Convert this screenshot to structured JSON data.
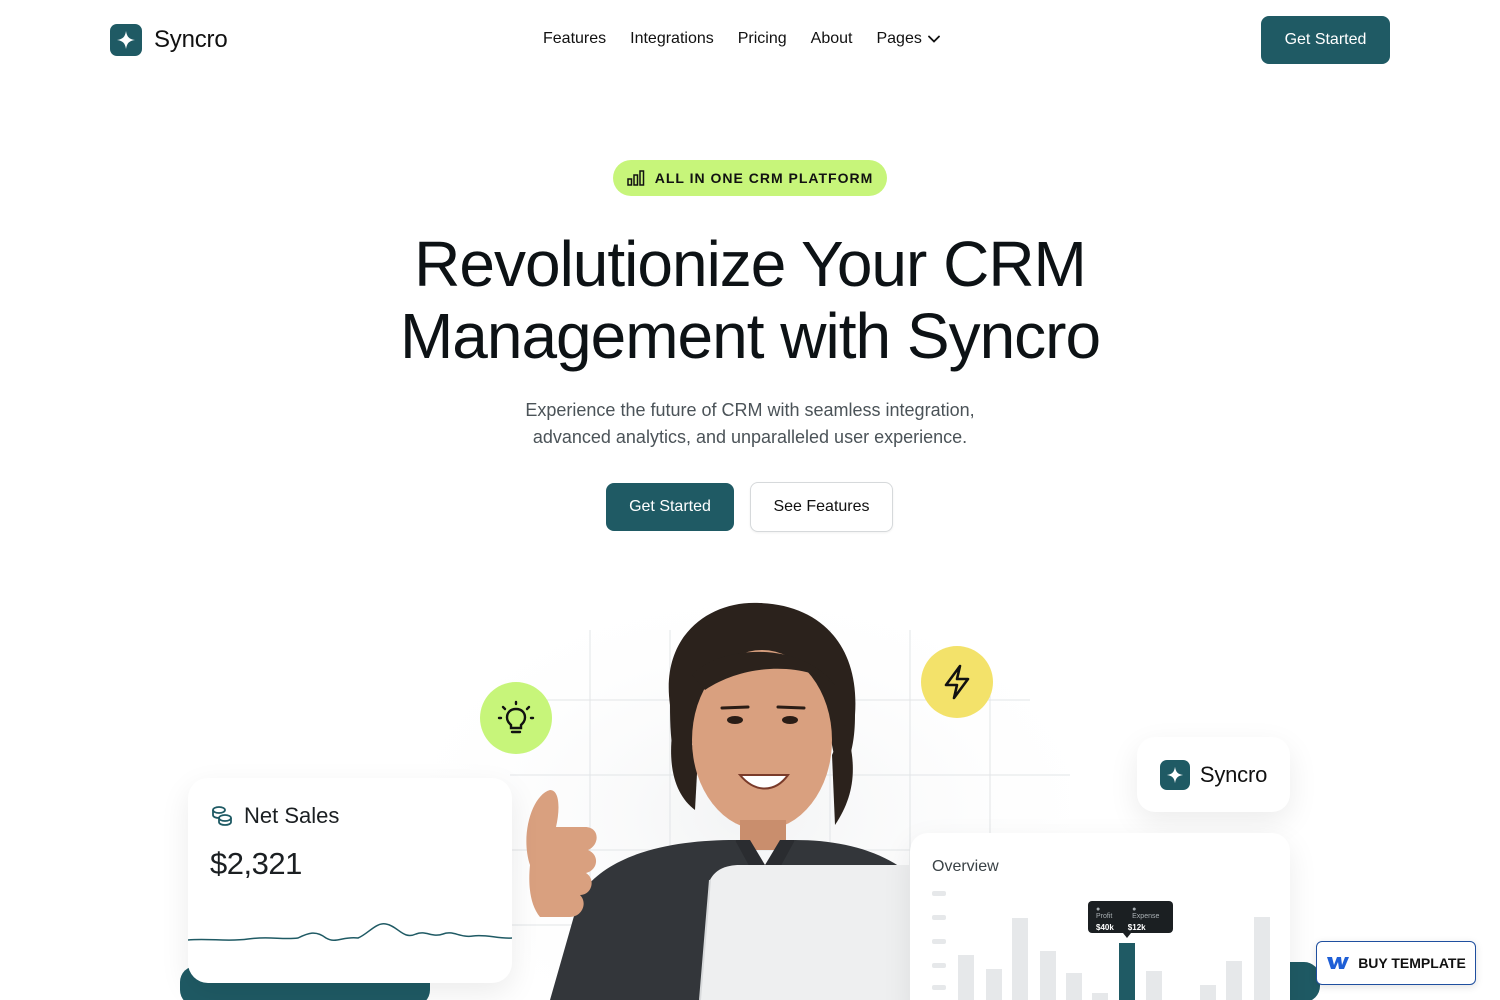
{
  "nav": {
    "brand": "Syncro",
    "links": [
      "Features",
      "Integrations",
      "Pricing",
      "About",
      "Pages"
    ],
    "cta": "Get Started"
  },
  "hero": {
    "badge": "ALL IN ONE CRM PLATFORM",
    "headline_line1": "Revolutionize Your CRM",
    "headline_line2": "Management with Syncro",
    "subtitle_line1": "Experience the future of CRM with seamless integration,",
    "subtitle_line2": "advanced analytics, and unparalleled user experience.",
    "primary_cta": "Get Started",
    "secondary_cta": "See Features"
  },
  "cards": {
    "net_sales": {
      "title": "Net Sales",
      "value": "$2,321"
    },
    "logo": {
      "name": "Syncro"
    },
    "overview": {
      "title": "Overview",
      "tooltip": {
        "profit_label": "Profit",
        "expense_label": "Expense",
        "profit_value": "$40k",
        "expense_value": "$12k"
      }
    }
  },
  "buy_template": {
    "label": "BUY TEMPLATE"
  },
  "colors": {
    "accent": "#1f5a64",
    "lime": "#c7f57a",
    "yellow": "#f3e26a",
    "webflow_blue": "#1f4f9f"
  },
  "icons": [
    "sparkle-logo-icon",
    "chevron-down-icon",
    "bar-chart-icon",
    "lightbulb-icon",
    "lightning-icon",
    "coins-icon",
    "webflow-icon"
  ]
}
